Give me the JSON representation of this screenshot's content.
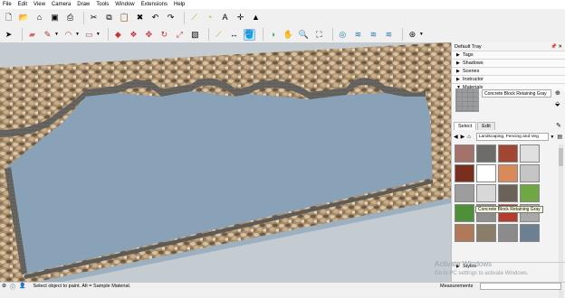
{
  "menu": [
    "File",
    "Edit",
    "View",
    "Camera",
    "Draw",
    "Tools",
    "Window",
    "Extensions",
    "Help"
  ],
  "toolbar1_icons": [
    "new-file-icon",
    "open-folder-icon",
    "house-icon",
    "save-icon",
    "print-icon",
    "sep",
    "cut-icon",
    "copy-icon",
    "paste-icon",
    "erase-icon",
    "undo-icon",
    "redo-icon",
    "sep",
    "tape-icon",
    "protractor-icon",
    "text-icon",
    "axes-icon",
    "dimension-icon"
  ],
  "toolbar2_icons": [
    "select-icon",
    "eraser-icon",
    "pencil-icon",
    "line-icon",
    "arc-icon",
    "shape-icon",
    "push-pull-icon",
    "move-icon",
    "rotate-icon",
    "scale-icon",
    "offset-icon",
    "follow-me-icon",
    "tape-icon",
    "text-icon",
    "paint-bucket-icon",
    "orbit-icon",
    "pan-icon",
    "zoom-icon",
    "zoom-extents-icon",
    "warehouse-icon",
    "extension-icon",
    "sandbox-icon",
    "layout-icon"
  ],
  "tray": {
    "title": "Default Tray",
    "panels": [
      "Tags",
      "Shadows",
      "Scenes",
      "Instructor",
      "Materials"
    ],
    "material_name": "Concrete Block Retaining Gray",
    "tabs": [
      "Select",
      "Edit"
    ],
    "library": "Landscaping, Fencing and Veg",
    "tooltip": "Concrete Block Retaining Gray",
    "styles_label": "Styles",
    "swatch_colors": [
      "#a2726b",
      "#6d6c6a",
      "#a04632",
      "#e0e0e0",
      "#7a2e1e",
      "#ffffff",
      "#d98a5a",
      "#c5c5c5",
      "#9d9d9d",
      "#d8d8d8",
      "#6b6258",
      "#6fa843",
      "#4e8f3a",
      "#8e8e8e",
      "#b23d2d",
      "#a9a9a9",
      "#b07a5a",
      "#8a7d6a",
      "#8b8b8b",
      "#6d7f93"
    ]
  },
  "activate_windows": [
    "Activate Windows",
    "Go to PC settings to activate Windows."
  ],
  "status": {
    "message": "Select object to paint. Alt = Sample Material.",
    "measurements_label": "Measurements"
  },
  "colors": {
    "water": "#8fa7bd",
    "rock": "#b89c78",
    "wall": "#6d6b68",
    "ground": "#c8d0d4"
  }
}
